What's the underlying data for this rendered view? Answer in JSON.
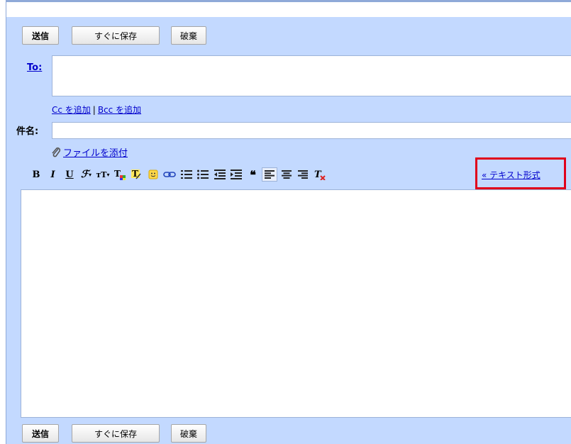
{
  "top_buttons": {
    "send": "送信",
    "save_now": "すぐに保存",
    "discard": "破棄"
  },
  "to": {
    "label": "To:",
    "value": ""
  },
  "cc_link": "Cc を追加",
  "separator": "|",
  "bcc_link": "Bcc を追加",
  "subject": {
    "label": "件名:",
    "value": ""
  },
  "attach_link": "ファイルを添付",
  "toolbar": {
    "items": [
      "bold-icon",
      "italic-icon",
      "underline-icon",
      "font-icon",
      "font-size-icon",
      "text-color-icon",
      "highlight-color-icon",
      "emoticon-icon",
      "link-icon",
      "numbered-list-icon",
      "bullet-list-icon",
      "indent-less-icon",
      "indent-more-icon",
      "quote-icon",
      "align-left-icon",
      "align-center-icon",
      "align-right-icon",
      "remove-formatting-icon"
    ],
    "plain_text_link": "« テキスト形式"
  },
  "body_text": "",
  "bottom_buttons": {
    "send": "送信",
    "save_now": "すぐに保存",
    "discard": "破棄"
  },
  "colors": {
    "panel": "#c3d9ff",
    "highlight_box": "#e0001b",
    "link": "#0000cc"
  }
}
